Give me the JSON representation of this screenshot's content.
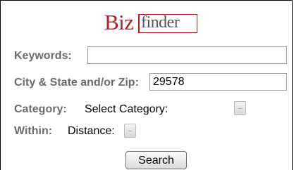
{
  "logo": {
    "part1": "Biz",
    "part2": "finder"
  },
  "form": {
    "keywords": {
      "label": "Keywords:",
      "value": ""
    },
    "location": {
      "label": "City & State and/or Zip:",
      "value": "29578"
    },
    "category": {
      "label": "Category:",
      "selected": "Select Category:"
    },
    "within": {
      "label": "Within:",
      "selected": "Distance:"
    }
  },
  "search_button": {
    "label": "Search"
  },
  "colors": {
    "brand_red": "#b01e24",
    "label_gray": "#6b6b6b"
  }
}
